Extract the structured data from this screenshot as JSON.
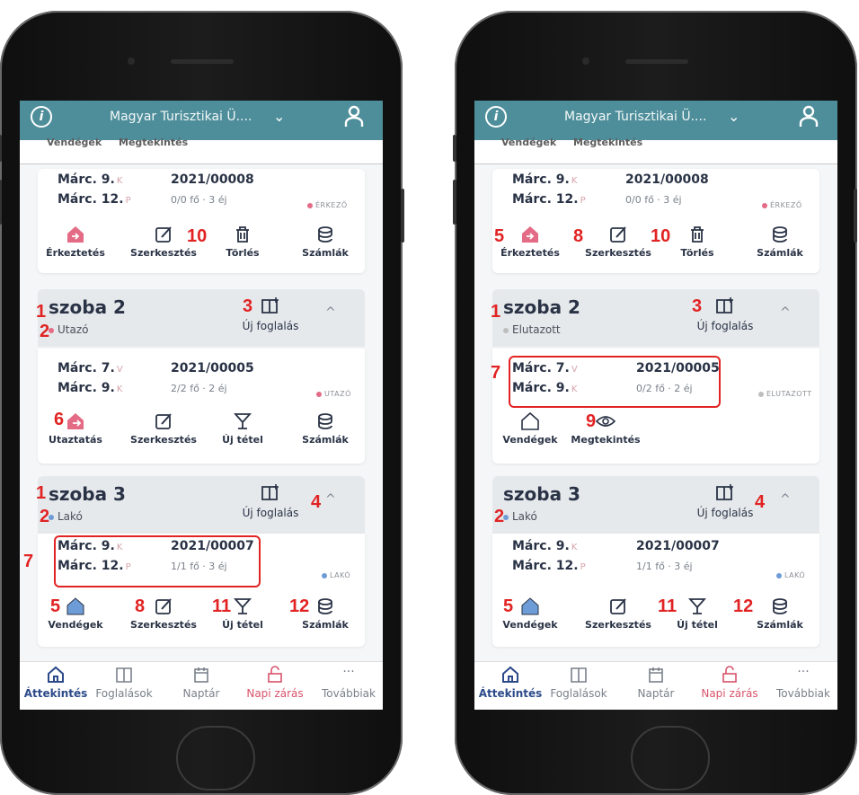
{
  "topbar": {
    "org": "Magyar Turisztikai Ü....",
    "chevron": "⌄"
  },
  "prev_row": {
    "guests": "Vendégek",
    "view": "Megtekintés"
  },
  "phones": [
    {
      "card0": {
        "arr": "Márc. 9.",
        "arr_dow": "K",
        "dep": "Márc. 12.",
        "dep_dow": "P",
        "num": "2021/00008",
        "pax": "0/0 fő · 3 éj",
        "status": "ÉRKEZŐ",
        "actions": [
          "Érkeztetés",
          "Szerkesztés",
          "Törlés",
          "Számlák"
        ]
      },
      "room2": {
        "name": "szoba 2",
        "status": "Utazó",
        "new_booking": "Új foglalás"
      },
      "card2": {
        "arr": "Márc. 7.",
        "arr_dow": "V",
        "dep": "Márc. 9.",
        "dep_dow": "K",
        "num": "2021/00005",
        "pax": "2/2 fő · 2 éj",
        "status": "UTAZÓ",
        "actions": [
          "Utaztatás",
          "Szerkesztés",
          "Új tétel",
          "Számlák"
        ]
      },
      "room3": {
        "name": "szoba 3",
        "status": "Lakó",
        "new_booking": "Új foglalás"
      },
      "card3": {
        "arr": "Márc. 9.",
        "arr_dow": "K",
        "dep": "Márc. 12.",
        "dep_dow": "P",
        "num": "2021/00007",
        "pax": "1/1 fő · 3 éj",
        "status": "LAKÓ",
        "actions": [
          "Vendégek",
          "Szerkesztés",
          "Új tétel",
          "Számlák"
        ]
      }
    },
    {
      "card0": {
        "arr": "Márc. 9.",
        "arr_dow": "K",
        "dep": "Márc. 12.",
        "dep_dow": "P",
        "num": "2021/00008",
        "pax": "0/0 fő · 3 éj",
        "status": "ÉRKEZŐ",
        "actions": [
          "Érkeztetés",
          "Szerkesztés",
          "Törlés",
          "Számlák"
        ]
      },
      "room2": {
        "name": "szoba 2",
        "status": "Elutazott",
        "new_booking": "Új foglalás"
      },
      "card2": {
        "arr": "Márc. 7.",
        "arr_dow": "V",
        "dep": "Márc. 9.",
        "dep_dow": "K",
        "num": "2021/00005",
        "pax": "0/2 fő · 2 éj",
        "status": "ELUTAZOTT",
        "actions": [
          "Vendégek",
          "Megtekintés"
        ]
      },
      "room3": {
        "name": "szoba 3",
        "status": "Lakó",
        "new_booking": "Új foglalás"
      },
      "card3": {
        "arr": "Márc. 9.",
        "arr_dow": "K",
        "dep": "Márc. 12.",
        "dep_dow": "P",
        "num": "2021/00007",
        "pax": "1/1 fő · 3 éj",
        "status": "LAKÓ",
        "actions": [
          "Vendégek",
          "Szerkesztés",
          "Új tétel",
          "Számlák"
        ]
      }
    }
  ],
  "nav": [
    "Áttekintés",
    "Foglalások",
    "Naptár",
    "Napi zárás",
    "Továbbiak"
  ],
  "callouts": {
    "c1": "1",
    "c2": "2",
    "c3": "3",
    "c4": "4",
    "c5": "5",
    "c6": "6",
    "c7": "7",
    "c8": "8",
    "c9": "9",
    "c10": "10",
    "c11": "11",
    "c12": "12"
  },
  "colors": {
    "header": "#4e8e9a",
    "status_pink": "#e36b85",
    "status_blue": "#6e9cd6",
    "status_grey": "#bdbdbd",
    "callout": "#e12323"
  }
}
